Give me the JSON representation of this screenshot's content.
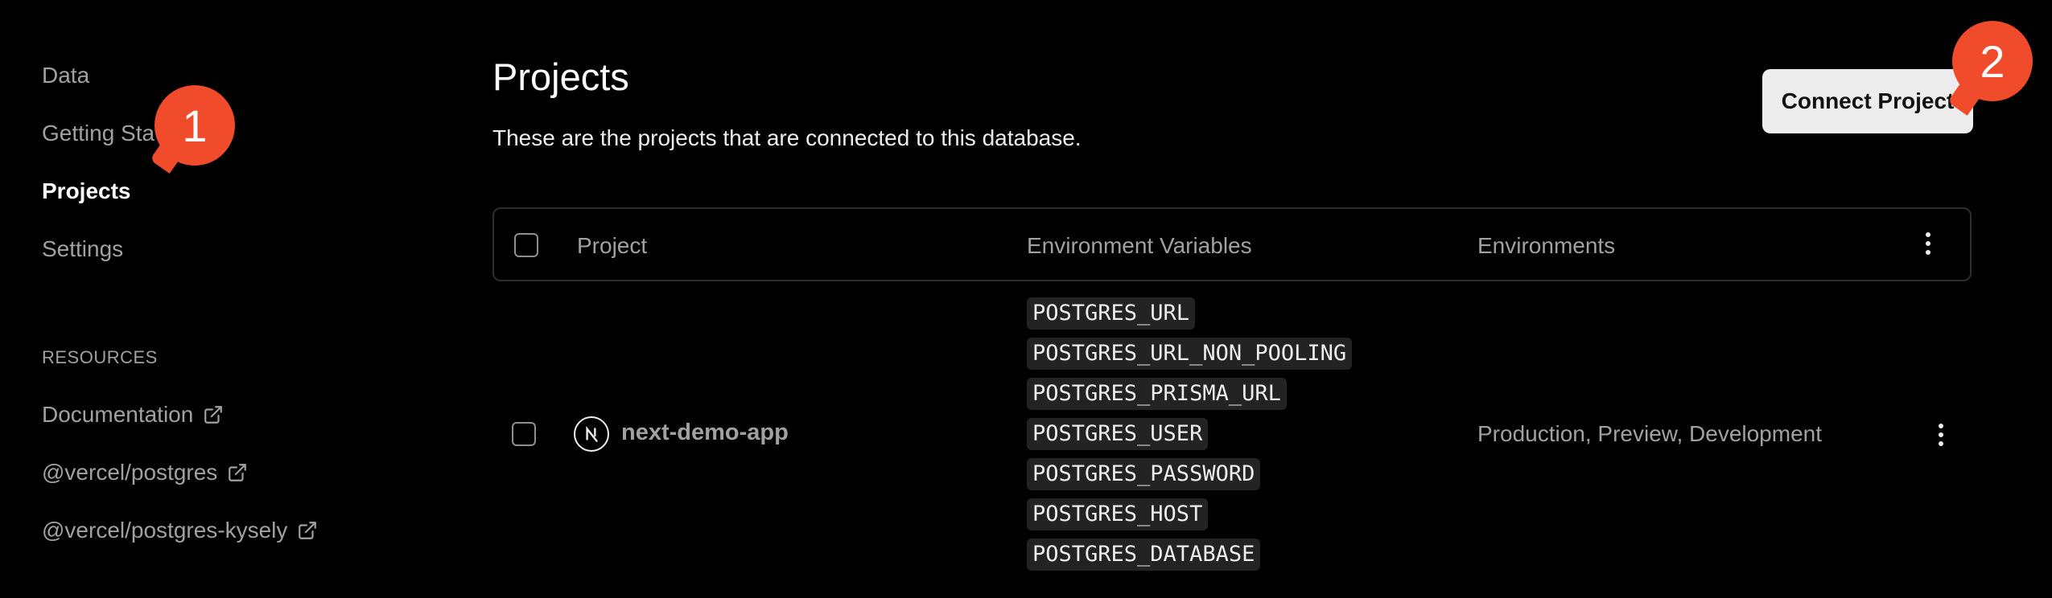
{
  "sidebar": {
    "nav": [
      {
        "label": "Data",
        "active": false
      },
      {
        "label": "Getting Sta",
        "active": false
      },
      {
        "label": "Projects",
        "active": true
      },
      {
        "label": "Settings",
        "active": false
      }
    ],
    "resources_heading": "RESOURCES",
    "resources": [
      {
        "label": "Documentation",
        "icon": "external-link-icon"
      },
      {
        "label": "@vercel/postgres",
        "icon": "external-link-icon"
      },
      {
        "label": "@vercel/postgres-kysely",
        "icon": "external-link-icon"
      }
    ]
  },
  "main": {
    "title": "Projects",
    "description": "These are the projects that are connected to this database.",
    "connect_button": "Connect Project",
    "table": {
      "columns": [
        "Project",
        "Environment Variables",
        "Environments"
      ],
      "rows": [
        {
          "project": "next-demo-app",
          "icon": "nextjs-logo-icon",
          "env_vars": [
            "POSTGRES_URL",
            "POSTGRES_URL_NON_POOLING",
            "POSTGRES_PRISMA_URL",
            "POSTGRES_USER",
            "POSTGRES_PASSWORD",
            "POSTGRES_HOST",
            "POSTGRES_DATABASE"
          ],
          "environments": "Production, Preview, Development"
        }
      ]
    }
  },
  "callouts": [
    "1",
    "2"
  ],
  "colors": {
    "accent": "#f04c2c",
    "background": "#000000",
    "button_bg": "#ededed"
  }
}
